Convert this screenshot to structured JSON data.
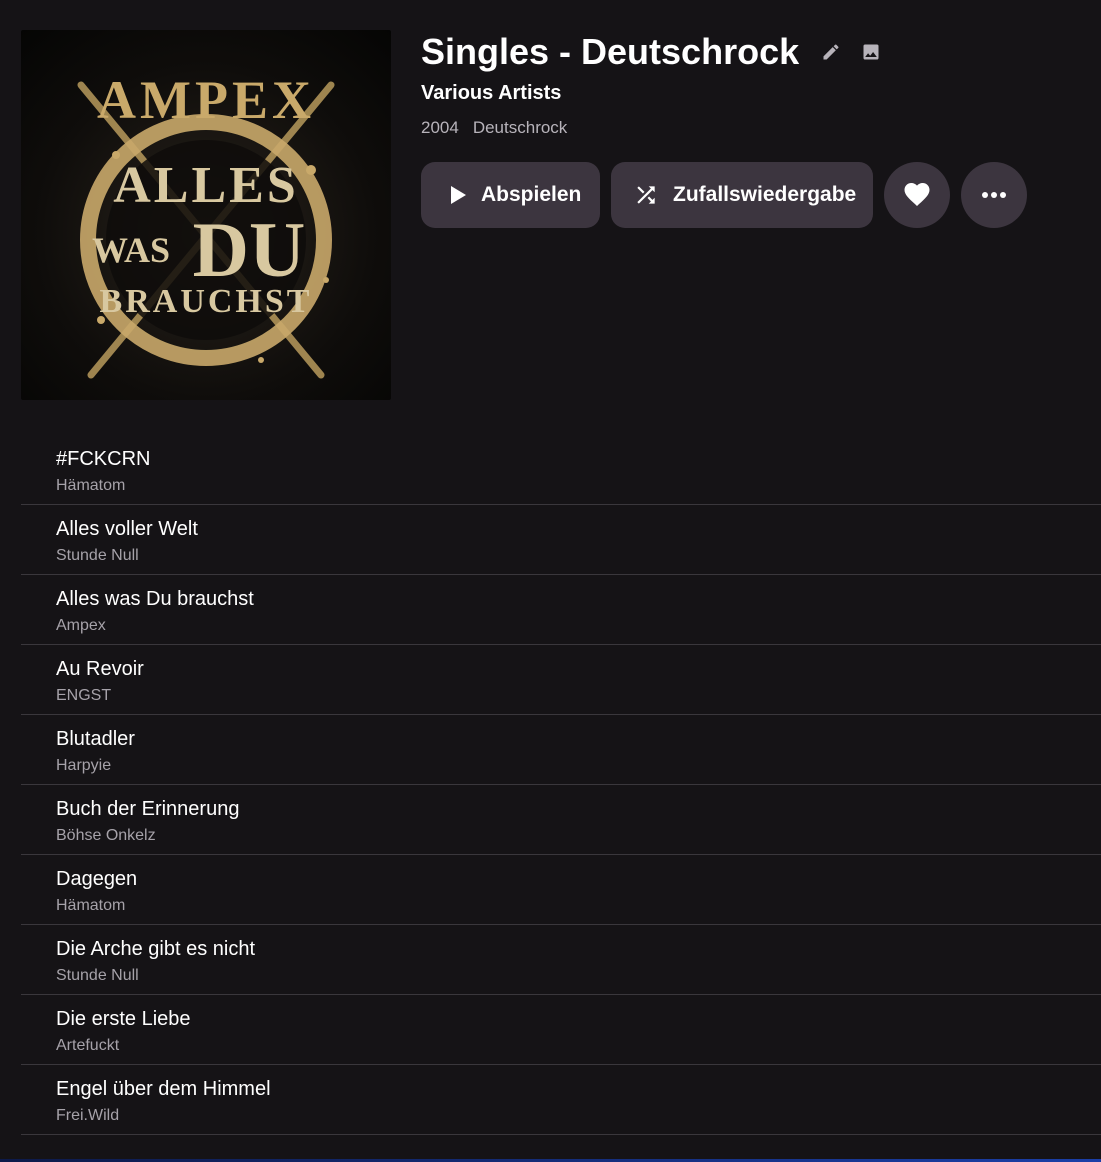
{
  "album": {
    "title": "Singles - Deutschrock",
    "artist": "Various Artists",
    "year": "2004",
    "genre": "Deutschrock",
    "cover_art": {
      "band_text": "AMPEX",
      "line1": "ALLES",
      "line2_small": "WAS",
      "line2_big": "DU",
      "line3": "BRAUCHST"
    }
  },
  "icons": {
    "edit": "pencil-icon",
    "image": "image-icon",
    "play": "play-icon",
    "shuffle": "shuffle-icon",
    "like": "heart-icon",
    "more": "more-horizontal-icon"
  },
  "actions": {
    "play_label": "Abspielen",
    "shuffle_label": "Zufallswiedergabe"
  },
  "colors": {
    "background": "#151316",
    "button_bg": "#3c353f",
    "secondary_text": "#a6a2a9",
    "divider": "#3a373c",
    "cover_gold": "#c9a96a"
  },
  "tracks": [
    {
      "title": "#FCKCRN",
      "artist": "Hämatom"
    },
    {
      "title": "Alles voller Welt",
      "artist": "Stunde Null"
    },
    {
      "title": "Alles was Du brauchst",
      "artist": "Ampex"
    },
    {
      "title": "Au Revoir",
      "artist": "ENGST"
    },
    {
      "title": "Blutadler",
      "artist": "Harpyie"
    },
    {
      "title": "Buch der Erinnerung",
      "artist": "Böhse Onkelz"
    },
    {
      "title": "Dagegen",
      "artist": "Hämatom"
    },
    {
      "title": "Die Arche gibt es nicht",
      "artist": "Stunde Null"
    },
    {
      "title": "Die erste Liebe",
      "artist": "Artefuckt"
    },
    {
      "title": "Engel über dem Himmel",
      "artist": "Frei.Wild"
    }
  ]
}
